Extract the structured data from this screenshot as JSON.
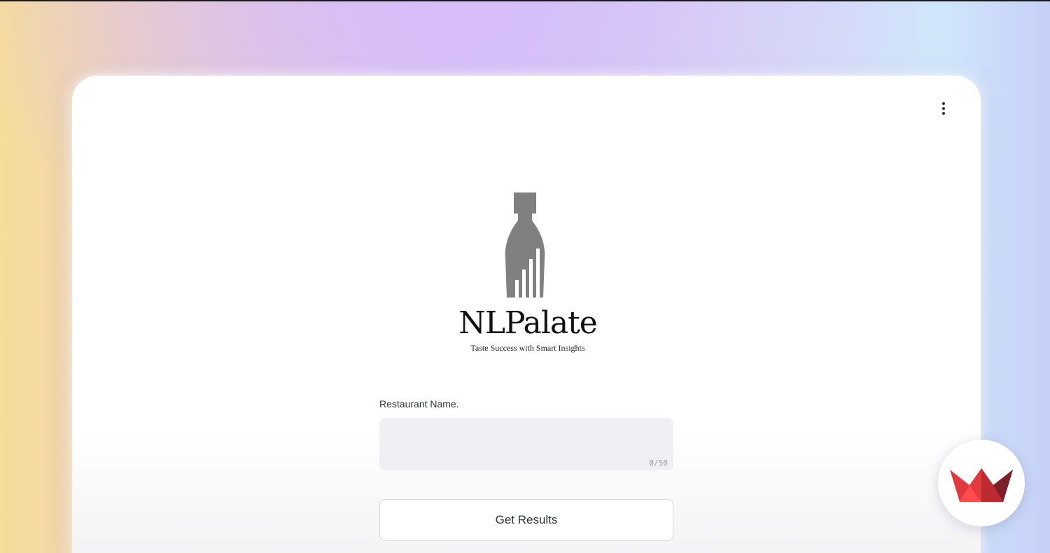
{
  "app": {
    "brand_name": "NLPalate",
    "tagline": "Taste Success with Smart Insights",
    "logo_icon": "bottle-fork-chart-icon"
  },
  "menu": {
    "icon": "kebab-menu-icon"
  },
  "form": {
    "restaurant_label": "Restaurant Name.",
    "restaurant_value": "",
    "char_counter": "0/50",
    "submit_label": "Get Results"
  },
  "badge": {
    "icon": "streamlit-crown-icon"
  },
  "colors": {
    "logo_gray": "#808080",
    "badge_red": "#e0393e",
    "input_bg": "#f0f0f4"
  }
}
